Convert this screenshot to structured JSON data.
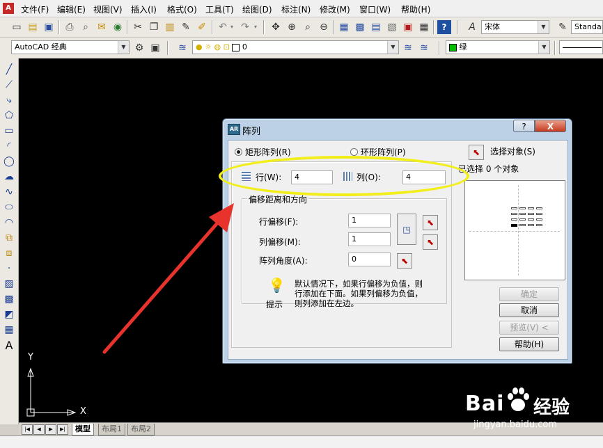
{
  "menubar": {
    "items": [
      "文件(F)",
      "编辑(E)",
      "视图(V)",
      "插入(I)",
      "格式(O)",
      "工具(T)",
      "绘图(D)",
      "标注(N)",
      "修改(M)",
      "窗口(W)",
      "帮助(H)"
    ]
  },
  "toolbar": {
    "font_combo": "宋体",
    "style_combo": "Standar",
    "workspace_combo": "AutoCAD 经典",
    "layer_combo": "0",
    "color_combo": "绿"
  },
  "layout_tabs": {
    "model": "模型",
    "layout1": "布局1",
    "layout2": "布局2"
  },
  "ucs": {
    "x_label": "X",
    "y_label": "Y"
  },
  "dialog": {
    "title": "阵列",
    "help_button": "?",
    "close_button": "X",
    "rect_array": "矩形阵列(R)",
    "polar_array": "环形阵列(P)",
    "rows_label": "行(W):",
    "rows_value": "4",
    "cols_label": "列(O):",
    "cols_value": "4",
    "offset_group": "偏移距离和方向",
    "row_offset_label": "行偏移(F):",
    "row_offset_value": "1",
    "col_offset_label": "列偏移(M):",
    "col_offset_value": "1",
    "angle_label": "阵列角度(A):",
    "angle_value": "0",
    "tip_label": "提示",
    "tip_text": "默认情况下，如果行偏移为负值，则行添加在下面。如果列偏移为负值，则列添加在左边。",
    "select_objects": "选择对象(S)",
    "selected_count": "已选择 0 个对象",
    "ok": "确定",
    "cancel": "取消",
    "preview": "预览(V) <",
    "help": "帮助(H)"
  },
  "watermark": {
    "brand": "Bai",
    "brand2": "经验",
    "url": "jingyan.baidu.com"
  },
  "colors": {
    "highlight": "#f2ee19",
    "arrow": "#e8332c",
    "canvas": "#000000",
    "layer_color": "#00c000"
  }
}
